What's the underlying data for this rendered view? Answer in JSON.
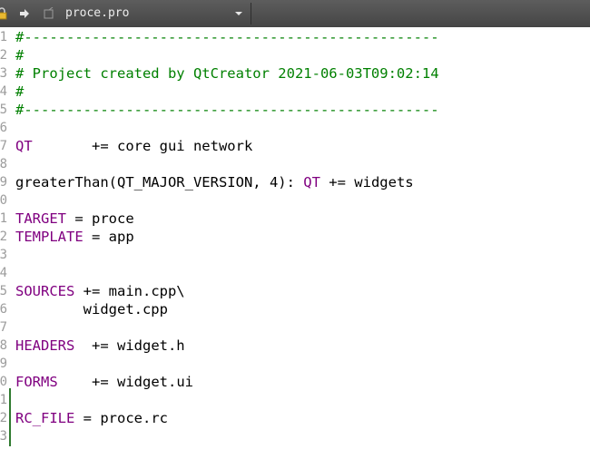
{
  "tab": {
    "title": "proce.pro",
    "icons": [
      "lock-icon",
      "arrow-right-icon",
      "file-icon",
      "chevron-down-icon"
    ]
  },
  "colors": {
    "tabbar": "#4e4e4e",
    "comment": "#008000",
    "variable": "#800080",
    "line_numbers": "#9c9c9c",
    "fold_marker": "#2f7a2f"
  },
  "lines": [
    {
      "num": "1",
      "parts": [
        {
          "t": "#-------------------------------------------------",
          "c": "comment"
        }
      ]
    },
    {
      "num": "2",
      "parts": [
        {
          "t": "#",
          "c": "comment"
        }
      ]
    },
    {
      "num": "3",
      "parts": [
        {
          "t": "# Project created by QtCreator 2021-06-03T09:02:14",
          "c": "comment"
        }
      ]
    },
    {
      "num": "4",
      "parts": [
        {
          "t": "#",
          "c": "comment"
        }
      ]
    },
    {
      "num": "5",
      "parts": [
        {
          "t": "#-------------------------------------------------",
          "c": "comment"
        }
      ]
    },
    {
      "num": "6",
      "parts": []
    },
    {
      "num": "7",
      "parts": [
        {
          "t": "QT",
          "c": "var"
        },
        {
          "t": "       += core gui network",
          "c": "plain"
        }
      ]
    },
    {
      "num": "8",
      "parts": []
    },
    {
      "num": "9",
      "parts": [
        {
          "t": "greaterThan(QT_MAJOR_VERSION, 4): ",
          "c": "plain"
        },
        {
          "t": "QT",
          "c": "var"
        },
        {
          "t": " += widgets",
          "c": "plain"
        }
      ]
    },
    {
      "num": "0",
      "parts": []
    },
    {
      "num": "1",
      "parts": [
        {
          "t": "TARGET",
          "c": "var"
        },
        {
          "t": " = proce",
          "c": "plain"
        }
      ]
    },
    {
      "num": "2",
      "parts": [
        {
          "t": "TEMPLATE",
          "c": "var"
        },
        {
          "t": " = app",
          "c": "plain"
        }
      ]
    },
    {
      "num": "3",
      "parts": []
    },
    {
      "num": "4",
      "parts": []
    },
    {
      "num": "5",
      "parts": [
        {
          "t": "SOURCES",
          "c": "var"
        },
        {
          "t": " += main.cpp\\",
          "c": "plain"
        }
      ]
    },
    {
      "num": "6",
      "parts": [
        {
          "t": "        widget.cpp",
          "c": "plain"
        }
      ]
    },
    {
      "num": "7",
      "parts": []
    },
    {
      "num": "8",
      "parts": [
        {
          "t": "HEADERS",
          "c": "var"
        },
        {
          "t": "  += widget.h",
          "c": "plain"
        }
      ]
    },
    {
      "num": "9",
      "parts": []
    },
    {
      "num": "0",
      "parts": [
        {
          "t": "FORMS",
          "c": "var"
        },
        {
          "t": "    += widget.ui",
          "c": "plain"
        }
      ]
    },
    {
      "num": "1",
      "parts": []
    },
    {
      "num": "2",
      "parts": [
        {
          "t": "RC_FILE",
          "c": "var"
        },
        {
          "t": " = proce.rc",
          "c": "plain"
        }
      ]
    },
    {
      "num": "3",
      "parts": []
    }
  ]
}
